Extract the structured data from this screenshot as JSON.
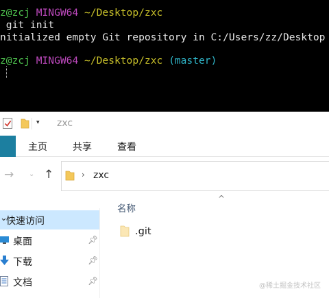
{
  "terminal": {
    "line1": {
      "user": "z@zcj",
      "shell": "MINGW64",
      "path": "~/Desktop/zxc"
    },
    "line2": {
      "command": " git init"
    },
    "line3": {
      "output": "nitialized empty Git repository in C:/Users/zz/Desktop"
    },
    "line4": {
      "user": "z@zcj",
      "shell": "MINGW64",
      "path": "~/Desktop/zxc",
      "branch": "(master)"
    }
  },
  "explorer": {
    "title": "zxc",
    "quick_access_dropdown": "▾",
    "ribbon_tabs": [
      "主页",
      "共享",
      "查看"
    ],
    "address": {
      "folder": "zxc",
      "separator": "›"
    },
    "nav": {
      "forward": "→",
      "recent": "⌄",
      "up": "↑"
    },
    "sidebar": {
      "quick_access": "快速访问",
      "items": [
        {
          "label": "桌面",
          "icon": "desktop-icon"
        },
        {
          "label": "下载",
          "icon": "download-icon"
        },
        {
          "label": "文档",
          "icon": "document-icon"
        }
      ]
    },
    "column_header": "名称",
    "sort_caret": "^",
    "files": [
      {
        "name": ".git",
        "icon": "folder-icon"
      }
    ]
  },
  "watermark": "@稀土掘金技术社区",
  "colors": {
    "terminal_bg": "#000000",
    "user_green": "#4ec24e",
    "host_magenta": "#c04ac0",
    "path_yellow": "#c8c02a",
    "branch_cyan": "#2fb6c9",
    "file_tab_blue": "#1c7fa0",
    "selected_bg": "#cce8ff"
  }
}
